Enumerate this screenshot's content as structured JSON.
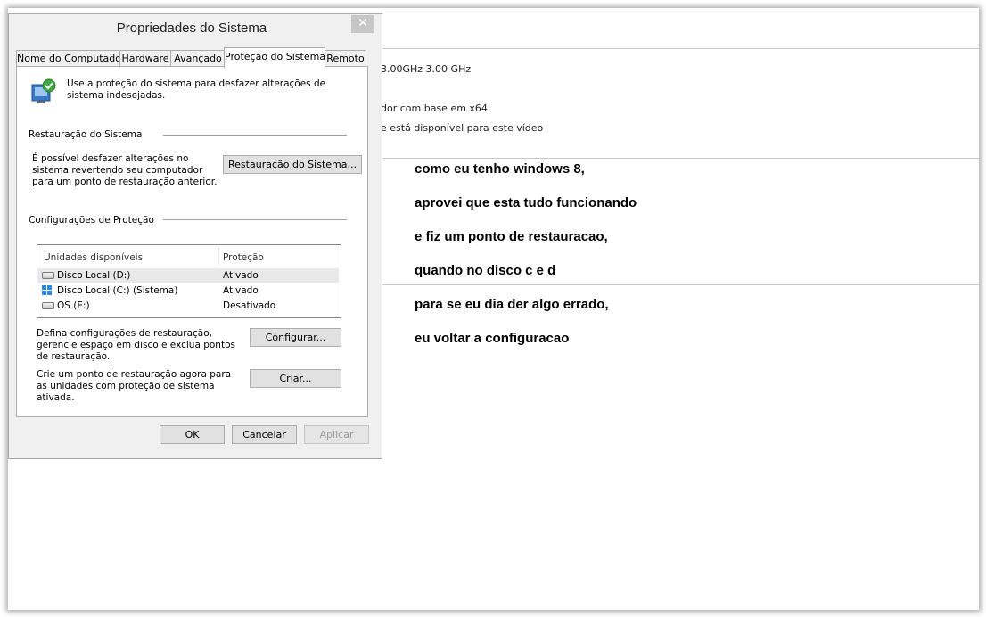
{
  "background": {
    "cpu_text": "3.00GHz   3.00 GHz",
    "system_type": "dor com base em x64",
    "pen_touch": "e está disponível para este vídeo",
    "message_lines": [
      "como eu tenho windows 8,",
      "aprovei que esta tudo funcionando",
      "e fiz um ponto de restauracao,",
      "quando no disco c e d",
      "para se eu dia der algo errado,",
      "eu voltar a configuracao"
    ]
  },
  "dialog": {
    "title": "Propriedades do Sistema",
    "close_glyph": "✕",
    "tabs": [
      "Nome do Computador",
      "Hardware",
      "Avançado",
      "Proteção do Sistema",
      "Remoto"
    ],
    "intro": "Use a proteção do sistema para desfazer alterações de sistema indesejadas.",
    "restore_section": "Restauração do Sistema",
    "restore_desc": "É possível desfazer alterações no sistema revertendo seu computador para um ponto de restauração anterior.",
    "restore_button": "Restauração do Sistema...",
    "protection_section": "Configurações de Proteção",
    "list_headers": [
      "Unidades disponíveis",
      "Proteção"
    ],
    "drives": [
      {
        "name": "Disco Local (D:)",
        "status": "Ativado",
        "icon": "drive-icon"
      },
      {
        "name": "Disco Local (C:) (Sistema)",
        "status": "Ativado",
        "icon": "windows-drive-icon"
      },
      {
        "name": "OS (E:)",
        "status": "Desativado",
        "icon": "drive-icon"
      }
    ],
    "config_desc": "Defina configurações de restauração, gerencie espaço em disco e exclua pontos de restauração.",
    "config_button": "Configurar...",
    "create_desc": "Crie um ponto de restauração agora para as unidades com proteção de sistema ativada.",
    "create_button": "Criar...",
    "ok_button": "OK",
    "cancel_button": "Cancelar",
    "apply_button": "Aplicar"
  }
}
